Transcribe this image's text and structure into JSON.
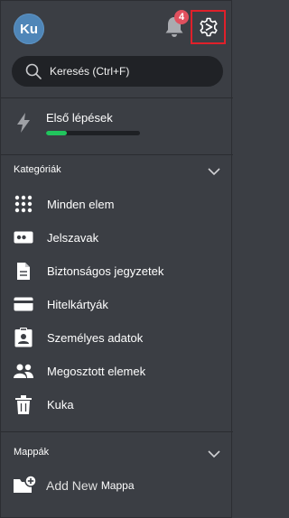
{
  "header": {
    "avatar_initials": "Ku",
    "notification_count": "4"
  },
  "search": {
    "placeholder": "Keresés (Ctrl+F)"
  },
  "getting_started": {
    "label": "Első lépések",
    "progress": 0.22,
    "progress_color": "#21c55d"
  },
  "categories": {
    "title": "Kategóriák",
    "items": [
      {
        "label": "Minden elem",
        "icon": "grid-icon"
      },
      {
        "label": "Jelszavak",
        "icon": "password-icon"
      },
      {
        "label": "Biztonságos jegyzetek",
        "icon": "note-icon"
      },
      {
        "label": "Hitelkártyák",
        "icon": "credit-card-icon"
      },
      {
        "label": "Személyes adatok",
        "icon": "id-card-icon"
      },
      {
        "label": "Megosztott elemek",
        "icon": "shared-users-icon"
      },
      {
        "label": "Kuka",
        "icon": "trash-icon"
      }
    ]
  },
  "folders": {
    "title": "Mappák",
    "add_new_label": "Add New",
    "add_new_suffix": "Mappa"
  },
  "colors": {
    "background": "#3b3e44",
    "search_background": "#202226",
    "badge": "#e0505e",
    "highlight_box": "#e0202a",
    "avatar": "#4f86b8"
  }
}
